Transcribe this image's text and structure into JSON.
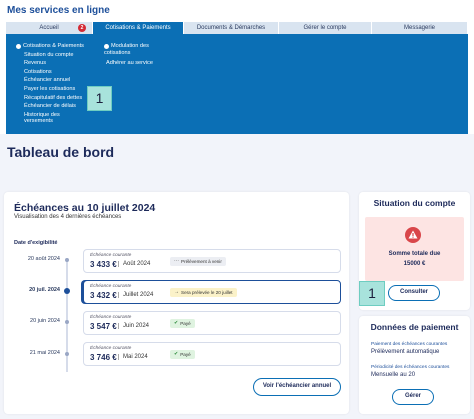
{
  "site_title": "Mes services en ligne",
  "tabs": [
    {
      "label": "Accueil",
      "badge": "2"
    },
    {
      "label": "Cotisations & Paiements"
    },
    {
      "label": "Documents & Démarches"
    },
    {
      "label": "Gérer le compte"
    },
    {
      "label": "Messagerie"
    }
  ],
  "menu": {
    "col1_head": "Cotisations & Paiements",
    "col1_items": [
      "Situation du compte",
      "Revenus",
      "Cotisations",
      "Échéancier annuel",
      "Payer les cotisations",
      "Récapitulatif des dettes",
      "Échéancier de délais",
      "Historique des",
      "versements"
    ],
    "col2_head_1": "Modulation des",
    "col2_head_2": "cotisations",
    "col2_items": [
      "Adhérer au service"
    ],
    "marker": "1"
  },
  "page_title": "Tableau de bord",
  "echeances": {
    "title": "Échéances au 10 juillet 2024",
    "subtitle": "Visualisation des 4 dernières échéances",
    "date_header": "Date d'exigibilité",
    "rows": [
      {
        "date": "20 août 2024",
        "label": "Échéance courante",
        "amount": "3 433 €",
        "period": "Août 2024",
        "status": "Prélèvement à venir"
      },
      {
        "date": "20 juil. 2024",
        "label": "Échéance courante",
        "amount": "3 432 €",
        "period": "Juillet 2024",
        "status": "Sera prélevée le 20 juillet"
      },
      {
        "date": "20 juin 2024",
        "label": "Échéance courante",
        "amount": "3 547 €",
        "period": "Juin 2024",
        "status": "Payé"
      },
      {
        "date": "21 mai 2024",
        "label": "Échéance courante",
        "amount": "3 746 €",
        "period": "Mai 2024",
        "status": "Payé"
      }
    ],
    "button": "Voir l'échéancier annuel"
  },
  "situation": {
    "title": "Situation du compte",
    "due_label": "Somme totale due",
    "due_amount": "15000 €",
    "marker": "1",
    "button": "Consulter"
  },
  "paiement": {
    "title": "Données de paiement",
    "pay_label": "Paiement des échéances courantes",
    "pay_value": "Prélèvement automatique",
    "freq_label": "Périodicité des échéances courantes",
    "freq_value": "Mensuelle au 20",
    "button": "Gérer"
  },
  "colors": {
    "brand": "#0b6fb5",
    "marker": "#a8e3dc",
    "alert": "#d9464a"
  }
}
